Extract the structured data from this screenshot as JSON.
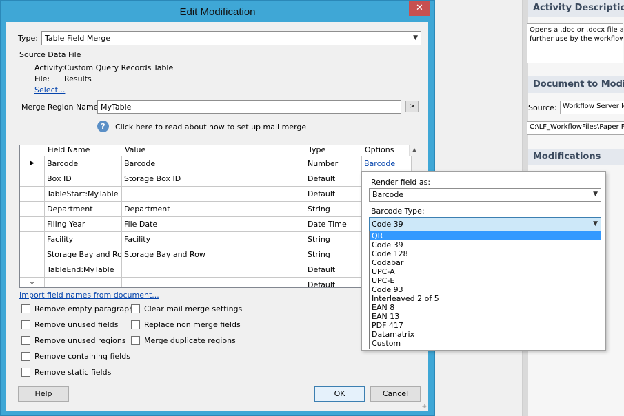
{
  "background": {
    "activity_description": {
      "heading": "Activity Description",
      "text_line1": "Opens a .doc or .docx file and",
      "text_line2": "further use by the workflow."
    },
    "document_to_modify": {
      "heading": "Document to Modify",
      "source_label": "Source:",
      "source_value": "Workflow Server lo",
      "path_value": "C:\\LF_WorkflowFiles\\Paper F"
    },
    "modifications": {
      "heading": "Modifications"
    }
  },
  "dialog": {
    "title": "Edit Modification",
    "close_symbol": "✕",
    "type_label": "Type:",
    "type_value": "Table Field Merge",
    "source_data_file_label": "Source Data File",
    "activity_label": "Activity:",
    "activity_value": "Custom Query Records Table",
    "file_label": "File:",
    "file_value": "Results",
    "select_link": "Select...",
    "merge_region_label": "Merge Region Name:",
    "merge_region_value": "MyTable",
    "merge_region_button": ">",
    "help_icon": "question-icon",
    "help_link_text": "Click here to read about how to set up mail merge",
    "grid": {
      "columns": [
        "Field Name",
        "Value",
        "Type",
        "Options"
      ],
      "rows": [
        {
          "field": "Barcode",
          "value": "Barcode",
          "type": "Number",
          "options": "Barcode"
        },
        {
          "field": "Box ID",
          "value": "Storage Box ID",
          "type": "Default",
          "options": ""
        },
        {
          "field": "TableStart:MyTable",
          "value": "",
          "type": "Default",
          "options": ""
        },
        {
          "field": "Department",
          "value": "Department",
          "type": "String",
          "options": ""
        },
        {
          "field": "Filing Year",
          "value": "File Date",
          "type": "Date Time",
          "options": ""
        },
        {
          "field": "Facility",
          "value": "Facility",
          "type": "String",
          "options": ""
        },
        {
          "field": "Storage Bay and Row",
          "value": "Storage Bay and Row",
          "type": "String",
          "options": ""
        },
        {
          "field": "TableEnd:MyTable",
          "value": "",
          "type": "Default",
          "options": ""
        },
        {
          "field": "",
          "value": "",
          "type": "Default",
          "options": ""
        }
      ],
      "current_row_marker": "▶",
      "new_row_marker": "*"
    },
    "import_link": "Import field names from document...",
    "checkboxes_left": [
      "Remove empty paragraphs",
      "Remove unused fields",
      "Remove unused regions",
      "Remove containing fields",
      "Remove static fields"
    ],
    "checkboxes_right": [
      "Clear mail merge settings",
      "Replace non merge fields",
      "Merge duplicate regions"
    ],
    "help_button": "Help",
    "ok_button": "OK",
    "cancel_button": "Cancel"
  },
  "popup": {
    "render_label": "Render field as:",
    "render_value": "Barcode",
    "barcode_type_label": "Barcode Type:",
    "barcode_type_value": "Code 39",
    "options": [
      "QR",
      "Code 39",
      "Code 128",
      "Codabar",
      "UPC-A",
      "UPC-E",
      "Code 93",
      "Interleaved 2 of 5",
      "EAN 8",
      "EAN 13",
      "PDF 417",
      "Datamatrix",
      "Custom"
    ],
    "highlighted_option": "QR"
  },
  "colors": {
    "title_bar": "#3fa7d6",
    "close_button": "#c75050",
    "highlight": "#3399ff",
    "link": "#0645ad",
    "selected_combo": "#cde8f9"
  }
}
